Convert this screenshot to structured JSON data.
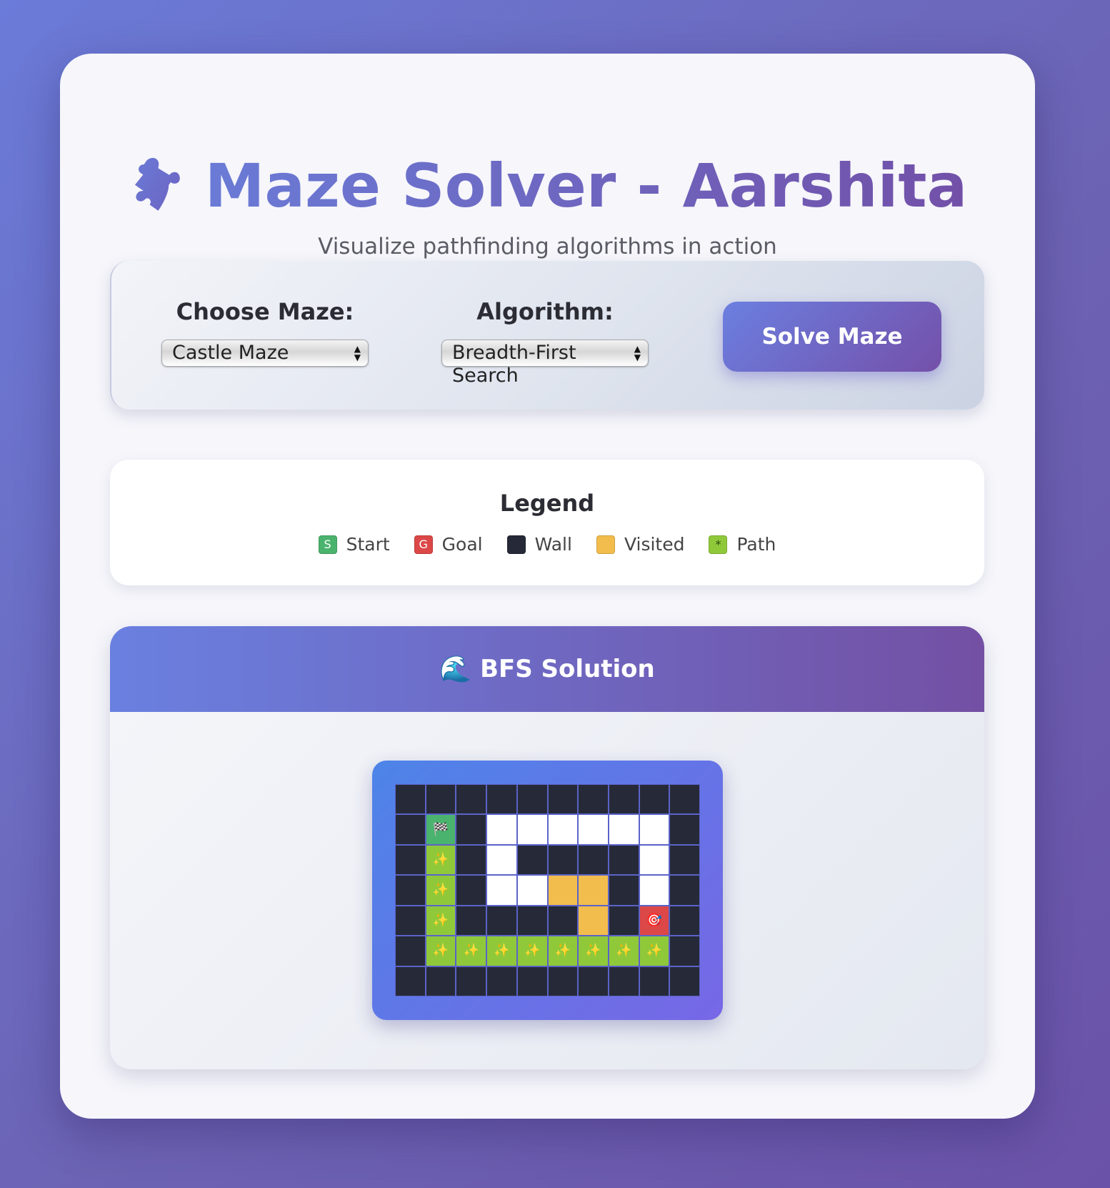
{
  "header": {
    "title": "Maze Solver - Aarshita",
    "subtitle": "Visualize pathfinding algorithms in action",
    "title_icon": "puzzle-piece-icon"
  },
  "controls": {
    "maze_label": "Choose Maze:",
    "maze_selected": "Castle Maze",
    "algorithm_label": "Algorithm:",
    "algorithm_selected": "Breadth-First Search",
    "solve_label": "Solve Maze"
  },
  "legend": {
    "title": "Legend",
    "items": [
      {
        "glyph": "S",
        "label": "Start",
        "color": "#4ab36d"
      },
      {
        "glyph": "G",
        "label": "Goal",
        "color": "#dc4747"
      },
      {
        "glyph": "",
        "label": "Wall",
        "color": "#262a38"
      },
      {
        "glyph": "",
        "label": "Visited",
        "color": "#f2bd4c"
      },
      {
        "glyph": "*",
        "label": "Path",
        "color": "#8fc93a"
      }
    ]
  },
  "solution": {
    "icon": "wave-icon",
    "title": "BFS Solution",
    "maze_rows": [
      "##########",
      "#S#......#",
      "#*#.####.#",
      "#*#..vv#.#",
      "#*####v#G#",
      "#********#",
      "##########"
    ]
  },
  "colors": {
    "accent_start": "#6a7bd6",
    "accent_end": "#7250a8",
    "wall": "#262a38",
    "visited": "#f2bd4c",
    "path": "#8fc93a",
    "start": "#4ab36d",
    "goal": "#dc4747"
  }
}
